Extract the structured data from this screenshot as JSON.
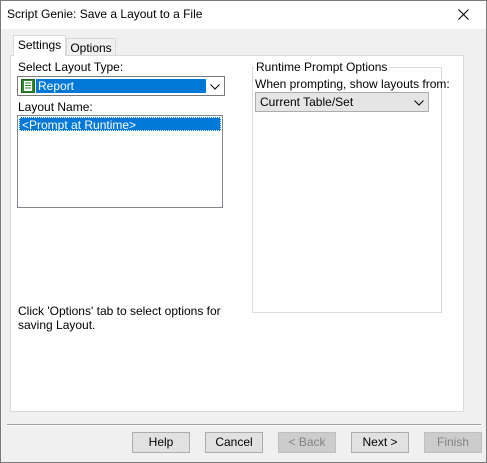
{
  "window": {
    "title": "Script Genie:  Save a Layout to a File"
  },
  "tabs": [
    {
      "label": "Settings",
      "active": true
    },
    {
      "label": "Options",
      "active": false
    }
  ],
  "settings": {
    "layout_type_label": "Select Layout Type:",
    "layout_type_value": "Report",
    "layout_name_label": "Layout Name:",
    "layout_name_items": [
      "<Prompt at Runtime>"
    ],
    "runtime_group_label": "Runtime Prompt Options",
    "prompt_label": "When prompting, show layouts from:",
    "prompt_value": "Current Table/Set",
    "info_text": "Click 'Options' tab to select options for saving Layout."
  },
  "buttons": {
    "help": "Help",
    "cancel": "Cancel",
    "back": "< Back",
    "next": "Next >",
    "finish": "Finish"
  },
  "colors": {
    "selection": "#0078d7",
    "button_face": "#e1e1e1"
  }
}
